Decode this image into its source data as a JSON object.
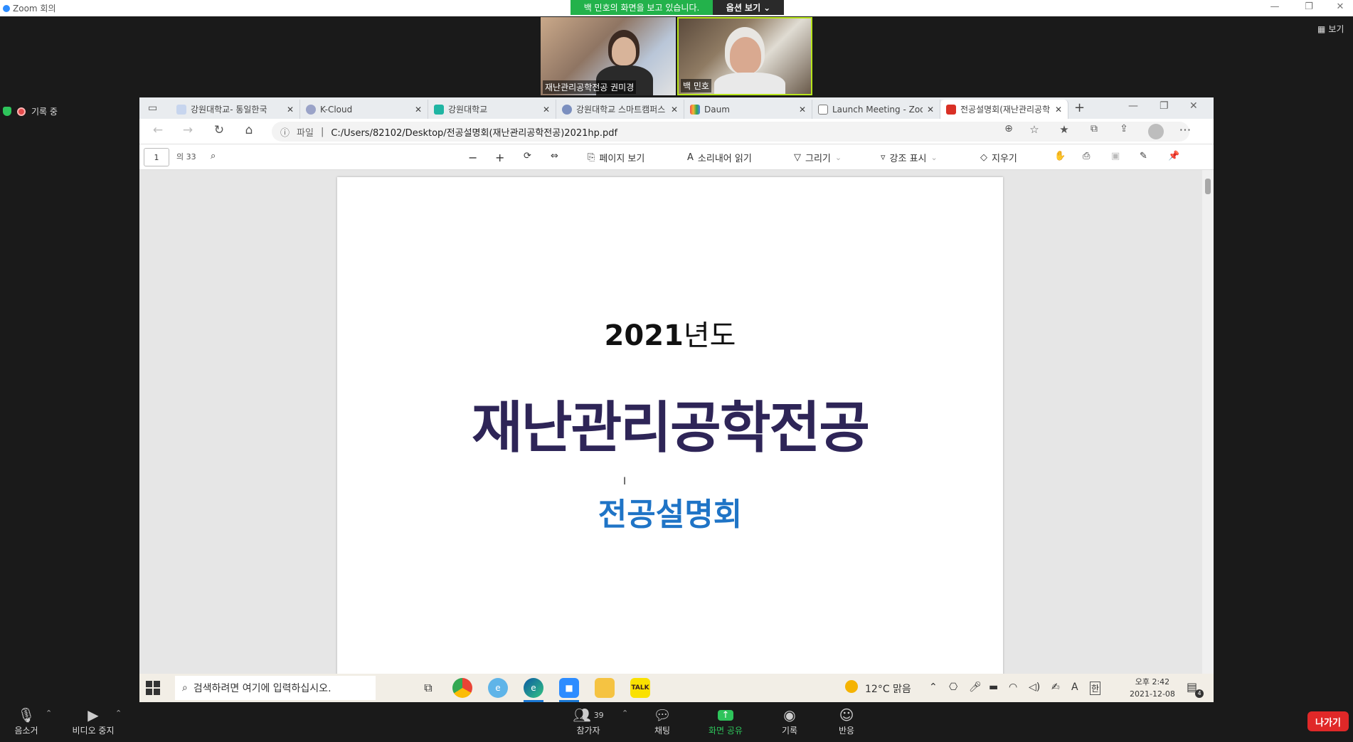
{
  "zoom": {
    "window_title": "Zoom 회의",
    "share_banner": "백 민호의 화면을 보고 있습니다.",
    "options_label": "옵션 보기",
    "view_label": "보기",
    "recording_label": "기록 중",
    "participants": [
      {
        "name": "재난관리공학전공 권미경"
      },
      {
        "name": "백 민호"
      }
    ],
    "toolbar": {
      "mute_label": "음소거",
      "video_label": "비디오 중지",
      "participants_label": "참가자",
      "participants_count": "39",
      "chat_label": "채팅",
      "share_label": "화면 공유",
      "record_label": "기록",
      "reactions_label": "반응",
      "leave_label": "나가기"
    },
    "colors": {
      "share_green": "#23b24b",
      "leave_red": "#e02828"
    }
  },
  "browser": {
    "tabs": [
      {
        "label": "강원대학교- 통일한국",
        "icon": "web-icon"
      },
      {
        "label": "K-Cloud",
        "icon": "cloud-icon"
      },
      {
        "label": "강원대학교",
        "icon": "m-logo-icon"
      },
      {
        "label": "강원대학교 스마트캠퍼스",
        "icon": "globe-icon"
      },
      {
        "label": "Daum",
        "icon": "daum-icon"
      },
      {
        "label": "Launch Meeting - Zoom",
        "icon": "doc-icon"
      },
      {
        "label": "전공설명회(재난관리공학전공)",
        "icon": "pdf-icon",
        "active": true
      }
    ],
    "address": {
      "scheme_label": "파일",
      "url": "C:/Users/82102/Desktop/전공설명회(재난관리공학전공)2021hp.pdf"
    }
  },
  "pdf": {
    "current_page": "1",
    "total_pages": "의 33",
    "tools": {
      "page_view": "페이지 보기",
      "read_aloud": "소리내어 읽기",
      "draw": "그리기",
      "highlight": "강조 표시",
      "erase": "지우기"
    },
    "page": {
      "year_number": "2021",
      "year_suffix": "년도",
      "major_title": "재난관리공학전공",
      "briefing": "전공설명회"
    }
  },
  "taskbar": {
    "search_placeholder": "검색하려면 여기에 입력하십시오.",
    "weather": "12°C  맑음",
    "ime_a": "A",
    "ime_han": "한",
    "time": "오후 2:42",
    "date": "2021-12-08",
    "notification_count": "4"
  }
}
